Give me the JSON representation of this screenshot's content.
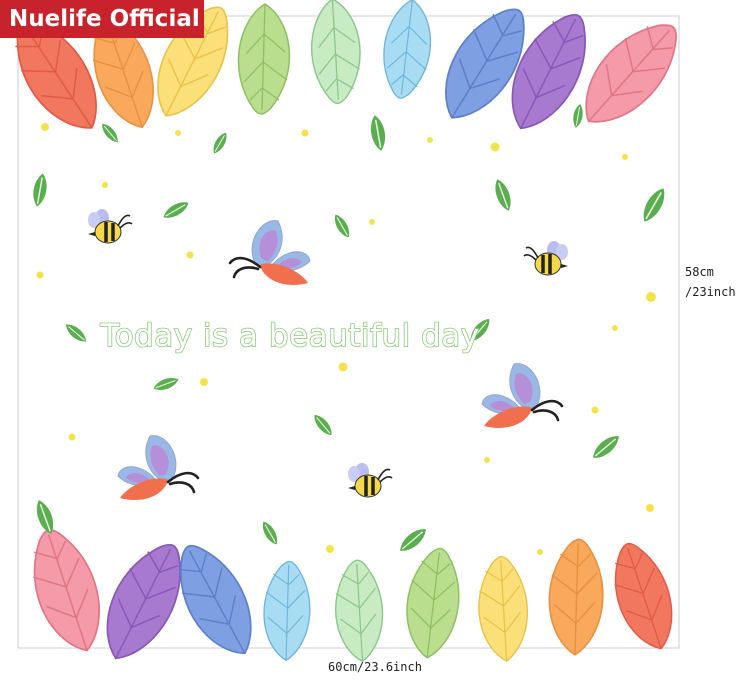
{
  "brand": {
    "label": "Nuelife Official",
    "color": "#c8232c"
  },
  "product": {
    "slogan": "Today is a beautiful day",
    "height_label_cm": "58cm",
    "height_label_in": "/23inch",
    "width_label": "60cm/23.6inch"
  },
  "colors": {
    "leaf_palette": [
      "#f1775e",
      "#f9a85c",
      "#fbe07a",
      "#b9df8e",
      "#c9ebc3",
      "#a8dcf3",
      "#7f9fe3",
      "#a77ad0",
      "#f59aa8"
    ],
    "small_leaf": "#5aae4f",
    "dot": "#f3e34b",
    "slogan_outline": "#8cc97a"
  },
  "icons": [
    "leaf-icon",
    "butterfly-icon",
    "bee-icon"
  ]
}
